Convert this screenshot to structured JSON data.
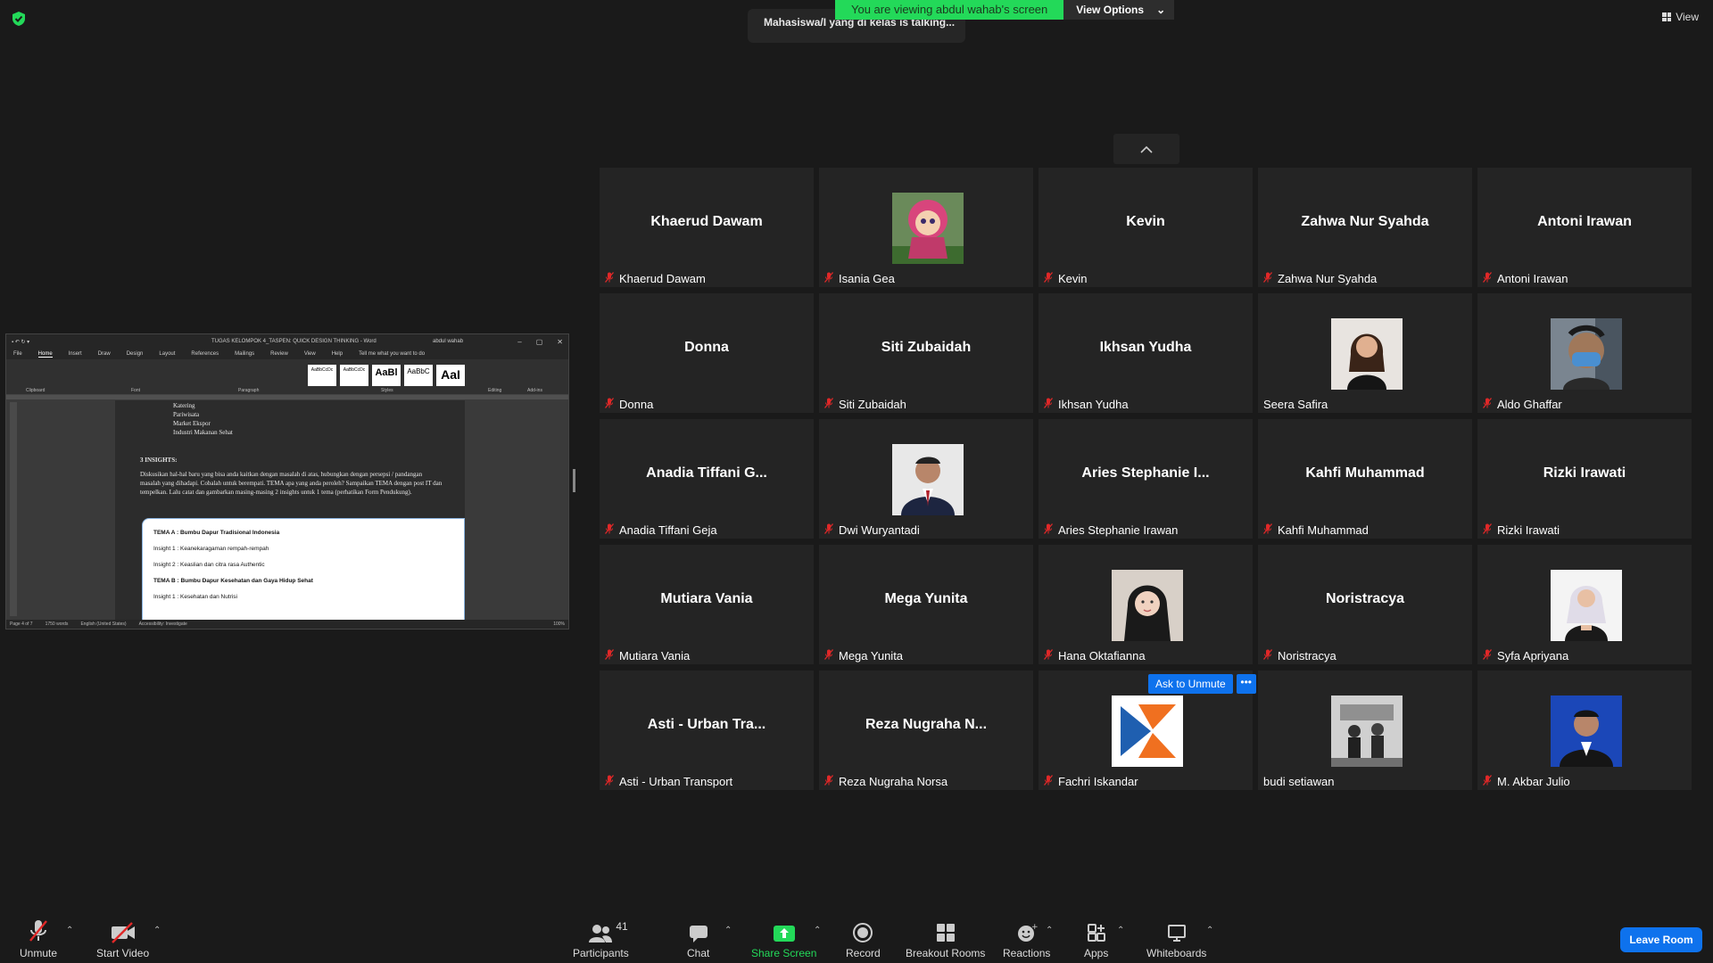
{
  "top": {
    "banner_text": "You are viewing abdul wahab's screen",
    "view_options": "View Options",
    "talking": "Mahasiswa/I yang di kelas is talking...",
    "view": "View"
  },
  "shared_doc": {
    "title": "TUGAS KELOMPOK 4_TASPEN: QUICK DESIGN THINKING  -  Word",
    "user": "abdul wahab",
    "tabs": [
      "File",
      "Home",
      "Insert",
      "Draw",
      "Design",
      "Layout",
      "References",
      "Mailings",
      "Review",
      "View",
      "Help",
      "Tell me what you want to do"
    ],
    "ribbon_groups": [
      "Clipboard",
      "Font",
      "Paragraph",
      "Styles",
      "Editing",
      "Add-ins"
    ],
    "styles": [
      "AaBbCcDc",
      "AaBbCcDc",
      "AaBl",
      "AaBbC",
      "AaI"
    ],
    "list_items": [
      "Katering",
      "Pariwisata",
      "Market Ekspor",
      "Industri Makanan Sehat"
    ],
    "heading": "3 INSIGHTS:",
    "paragraph": "Diskusikan hal-hal baru yang bisa anda kaitkan dengan masalah di atas, hubungkan dengan persepsi / pandangan masalah yang dihadapi. Cobalah untuk berempati. TEMA apa yang anda peroleh? Sampaikan TEMA dengan post IT dan tempelkan. Lalu catat dan gambarkan masing-masing 2 insights untuk 1 tema (perhatikan Form Pendukung).",
    "box_lines": [
      "TEMA A : Bumbu Dapur Tradisional Indonesia",
      "Insight 1 : Keanekaragaman rempah-rempah",
      "Insight 2 : Keaslian dan citra rasa Authentic",
      "TEMA B : Bumbu Dapur Kesehatan dan Gaya Hidup Sehat",
      "Insight 1 : Kesehatan dan Nutrisi"
    ],
    "status": [
      "Page 4 of 7",
      "1750 words",
      "English (United States)",
      "Accessibility: Investigate",
      "100%"
    ]
  },
  "participants": [
    {
      "big": "Khaerud Dawam",
      "name": "Khaerud Dawam",
      "muted": true,
      "photo": null
    },
    {
      "big": "",
      "name": "Isania Gea",
      "muted": true,
      "photo": "cartoon"
    },
    {
      "big": "Kevin",
      "name": "Kevin",
      "muted": true,
      "photo": null
    },
    {
      "big": "Zahwa Nur Syahda",
      "name": "Zahwa Nur Syahda",
      "muted": true,
      "photo": null
    },
    {
      "big": "Antoni Irawan",
      "name": "Antoni Irawan",
      "muted": true,
      "photo": null
    },
    {
      "big": "Donna",
      "name": "Donna",
      "muted": true,
      "photo": null
    },
    {
      "big": "Siti Zubaidah",
      "name": "Siti Zubaidah",
      "muted": true,
      "photo": null
    },
    {
      "big": "Ikhsan Yudha",
      "name": "Ikhsan Yudha",
      "muted": true,
      "photo": null
    },
    {
      "big": "",
      "name": "Seera Safira",
      "muted": false,
      "photo": "woman"
    },
    {
      "big": "",
      "name": "Aldo Ghaffar",
      "muted": true,
      "photo": "mask"
    },
    {
      "big": "Anadia Tiffani G...",
      "name": "Anadia Tiffani Geja",
      "muted": true,
      "photo": null
    },
    {
      "big": "",
      "name": "Dwi Wuryantadi",
      "muted": true,
      "photo": "man-suit"
    },
    {
      "big": "Aries Stephanie I...",
      "name": "Aries Stephanie Irawan",
      "muted": true,
      "photo": null
    },
    {
      "big": "Kahfi Muhammad",
      "name": "Kahfi Muhammad",
      "muted": true,
      "photo": null
    },
    {
      "big": "Rizki Irawati",
      "name": "Rizki Irawati",
      "muted": true,
      "photo": null
    },
    {
      "big": "Mutiara Vania",
      "name": "Mutiara Vania",
      "muted": true,
      "photo": null
    },
    {
      "big": "Mega Yunita",
      "name": "Mega Yunita",
      "muted": true,
      "photo": null
    },
    {
      "big": "",
      "name": "Hana Oktafianna",
      "muted": true,
      "photo": "hijab"
    },
    {
      "big": "Noristracya",
      "name": "Noristracya",
      "muted": true,
      "photo": null
    },
    {
      "big": "",
      "name": "Syfa Apriyana",
      "muted": true,
      "photo": "hijab-white"
    },
    {
      "big": "Asti - Urban Tra...",
      "name": "Asti - Urban Transport",
      "muted": true,
      "photo": null
    },
    {
      "big": "Reza Nugraha N...",
      "name": "Reza Nugraha Norsa",
      "muted": true,
      "photo": null
    },
    {
      "big": "",
      "name": "Fachri Iskandar",
      "muted": true,
      "photo": "logo"
    },
    {
      "big": "",
      "name": "budi setiawan",
      "muted": false,
      "photo": "bw-group"
    },
    {
      "big": "",
      "name": "M. Akbar Julio",
      "muted": true,
      "photo": "blue-portrait"
    }
  ],
  "ask_to_unmute": "Ask to Unmute",
  "more": "•••",
  "toolbar": {
    "unmute": "Unmute",
    "start_video": "Start Video",
    "participants": "Participants",
    "participants_count": "41",
    "chat": "Chat",
    "share_screen": "Share Screen",
    "record": "Record",
    "breakout_rooms": "Breakout Rooms",
    "reactions": "Reactions",
    "apps": "Apps",
    "whiteboards": "Whiteboards",
    "leave_room": "Leave Room"
  },
  "colors": {
    "accent": "#0e72ed",
    "green": "#23d959",
    "mute_red": "#e02828",
    "tile": "#242424"
  }
}
